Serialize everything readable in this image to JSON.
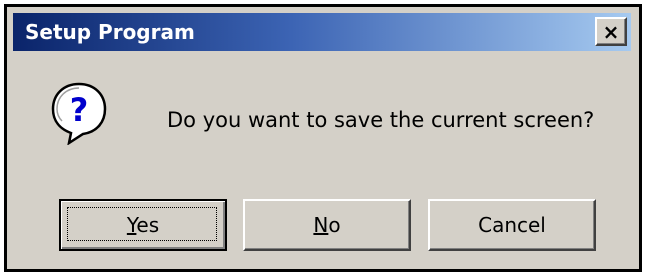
{
  "window": {
    "title": "Setup Program",
    "close_icon": "close-icon",
    "close_glyph": "×"
  },
  "dialog": {
    "icon": "question-icon",
    "message": "Do you want to save the current screen?"
  },
  "buttons": {
    "yes": {
      "mnemonic": "Y",
      "rest": "es",
      "default": true
    },
    "no": {
      "mnemonic": "N",
      "rest": "o"
    },
    "cancel": {
      "label": "Cancel"
    }
  },
  "colors": {
    "titlebar_start": "#0a246a",
    "titlebar_end": "#a6caf0",
    "dialog_face": "#d4d0c8",
    "icon_blue": "#0000cc"
  }
}
